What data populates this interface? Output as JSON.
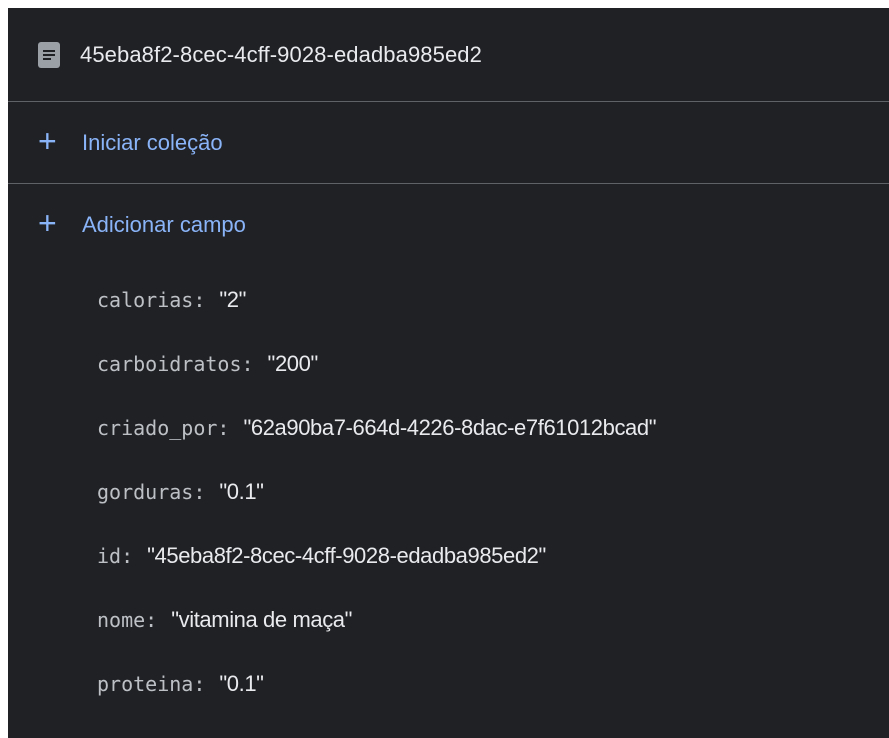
{
  "document": {
    "icon": "document-icon",
    "title": "45eba8f2-8cec-4cff-9028-edadba985ed2"
  },
  "actions": {
    "start_collection": "Iniciar coleção",
    "add_field": "Adicionar campo"
  },
  "fields": [
    {
      "key": "calorias",
      "value": "\"2\""
    },
    {
      "key": "carboidratos",
      "value": "\"200\""
    },
    {
      "key": "criado_por",
      "value": "\"62a90ba7-664d-4226-8dac-e7f61012bcad\""
    },
    {
      "key": "gorduras",
      "value": "\"0.1\""
    },
    {
      "key": "id",
      "value": "\"45eba8f2-8cec-4cff-9028-edadba985ed2\""
    },
    {
      "key": "nome",
      "value": "\"vitamina de maça\""
    },
    {
      "key": "proteina",
      "value": "\"0.1\""
    }
  ],
  "colors": {
    "background": "#202124",
    "accent": "#8ab4f8",
    "text": "#e8eaed",
    "key_text": "#bdc1c6",
    "divider": "#5f6368"
  }
}
